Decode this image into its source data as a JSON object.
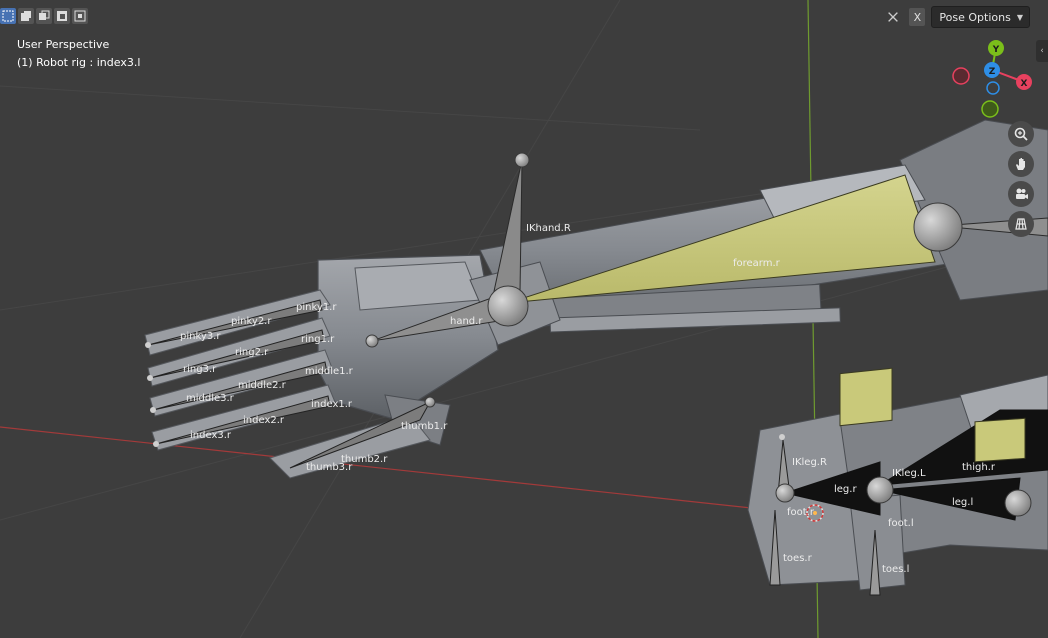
{
  "viewport": {
    "view_name": "User Perspective",
    "active_object": "(1) Robot rig : index3.l"
  },
  "header": {
    "select_modes": [
      "select-box-icon",
      "mode-new-icon",
      "mode-extend-icon",
      "mode-subtract-icon",
      "mode-intersect-icon"
    ],
    "x_label": "X",
    "pose_options_label": "Pose Options"
  },
  "gizmo": {
    "y": "Y",
    "z": "Z",
    "x": "X",
    "colors": {
      "x": "#e8415f",
      "y": "#7bbf1a",
      "z": "#2e8ee6"
    }
  },
  "navigation": [
    "zoom-icon",
    "pan-hand-icon",
    "camera-icon",
    "grid-ortho-icon"
  ],
  "bones": {
    "ikhand_r": "IKhand.R",
    "forearm_r": "forearm.r",
    "hand_r": "hand.r",
    "pinky1_r": "pinky1.r",
    "pinky2_r": "pinky2.r",
    "pinky3_r": "pinky3.r",
    "ring1_r": "ring1.r",
    "ring2_r": "ring2.r",
    "ring3_r": "ring3.r",
    "middle1_r": "middle1.r",
    "middle2_r": "middle2.r",
    "middle3_r": "middle3.r",
    "index1_r": "index1.r",
    "index2_r": "index2.r",
    "index3_r": "index3.r",
    "thumb1_r": "thumb1.r",
    "thumb2_r": "thumb2.r",
    "thumb3_r": "thumb3.r",
    "ikleg_r": "IKleg.R",
    "ikleg_l": "IKleg.L",
    "thigh_r": "thigh.r",
    "leg_r": "leg.r",
    "leg_l": "leg.l",
    "foot_r": "foot.r",
    "foot_l": "foot.l",
    "toes_r": "toes.r",
    "toes_l": "toes.l"
  },
  "colors": {
    "background": "#3d3d3d",
    "x_axis": "#a33a3a",
    "y_axis": "#6f9b2f",
    "selected_bone": "#c9c97a",
    "mesh": "#8a8d92"
  }
}
